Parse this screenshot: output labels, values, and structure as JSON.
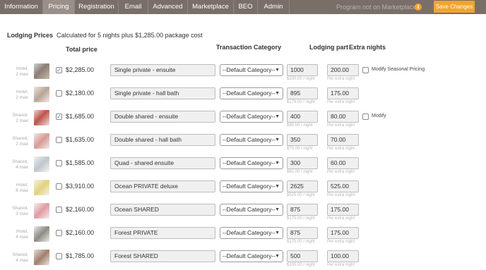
{
  "tabs": [
    {
      "label": "Information",
      "active": false
    },
    {
      "label": "Pricing",
      "active": true
    },
    {
      "label": "Registration",
      "active": false
    },
    {
      "label": "Email",
      "active": false
    },
    {
      "label": "Advanced",
      "active": false
    },
    {
      "label": "Marketplace",
      "active": false
    },
    {
      "label": "BEO",
      "active": false
    },
    {
      "label": "Admin",
      "active": false
    }
  ],
  "header": {
    "notice": "Program not on Marketplace",
    "save_label": "Save Changes"
  },
  "pricing": {
    "section_label": "Lodging Prices",
    "summary": "Calculated for 5 nights plus $1,285.00 package cost",
    "col_total": "Total price",
    "col_category": "Transaction Category",
    "col_lodging": "Lodging part",
    "col_extra": "Extra nights"
  },
  "rooms": [
    {
      "type": "Hotel,",
      "max": "2 max",
      "checked": true,
      "total": "$2,285.00",
      "name": "Single private - ensuite",
      "category": "--Default Category--",
      "lodging": "1000",
      "per_night": "$200.00 / night",
      "extra": "200.00",
      "extra_sub": "Per extra night",
      "modify_label": "Modify Seasonal Pricing"
    },
    {
      "type": "Hotel,",
      "max": "2 max",
      "checked": false,
      "total": "$2,180.00",
      "name": "Single private - hall bath",
      "category": "--Default Category--",
      "lodging": "895",
      "per_night": "$179.00 / night",
      "extra": "175.00",
      "extra_sub": "Per extra night"
    },
    {
      "type": "Shared,",
      "max": "2 max",
      "checked": true,
      "total": "$1,685.00",
      "name": "Double shared - ensuite",
      "category": "--Default Category--",
      "lodging": "400",
      "per_night": "$80.00 / night",
      "extra": "80.00",
      "extra_sub": "Per extra night",
      "modify_label": "Modify"
    },
    {
      "type": "Shared,",
      "max": "2 max",
      "checked": false,
      "total": "$1,635.00",
      "name": "Double shared - hall bath",
      "category": "--Default Category--",
      "lodging": "350",
      "per_night": "$70.00 / night",
      "extra": "70.00",
      "extra_sub": "Per extra night"
    },
    {
      "type": "Shared,",
      "max": "4 max",
      "checked": false,
      "total": "$1,585.00",
      "name": "Quad - shared ensuite",
      "category": "--Default Category--",
      "lodging": "300",
      "per_night": "$60.00 / night",
      "extra": "60.00",
      "extra_sub": "Per extra night"
    },
    {
      "type": "Hotel,",
      "max": "6 max",
      "checked": false,
      "total": "$3,910.00",
      "name": "Ocean PRIVATE deluxe",
      "category": "--Default Category--",
      "lodging": "2625",
      "per_night": "$525.00 / night",
      "extra": "525.00",
      "extra_sub": "Per extra night"
    },
    {
      "type": "Shared,",
      "max": "3 max",
      "checked": false,
      "total": "$2,160.00",
      "name": "Ocean SHARED",
      "category": "--Default Category--",
      "lodging": "875",
      "per_night": "$175.00 / night",
      "extra": "175.00",
      "extra_sub": "Per extra night"
    },
    {
      "type": "Hotel,",
      "max": "4 max",
      "checked": false,
      "total": "$2,160.00",
      "name": "Forest PRIVATE",
      "category": "--Default Category--",
      "lodging": "875",
      "per_night": "$175.00 / night",
      "extra": "175.00",
      "extra_sub": "Per extra night"
    },
    {
      "type": "Shared,",
      "max": "4 max",
      "checked": false,
      "total": "$1,785.00",
      "name": "Forest SHARED",
      "category": "--Default Category--",
      "lodging": "500",
      "per_night": "$100.00 / night",
      "extra": "100.00",
      "extra_sub": "Per extra night"
    }
  ],
  "colors": {
    "tabbar": "#7a6e69",
    "tab_active": "#9a8f8a",
    "accent": "#f2a52b",
    "check": "#2d6fd0"
  },
  "icons": {
    "info": "info-icon",
    "select_arrow": "chevron-down-icon",
    "checkmark": "check-icon"
  }
}
